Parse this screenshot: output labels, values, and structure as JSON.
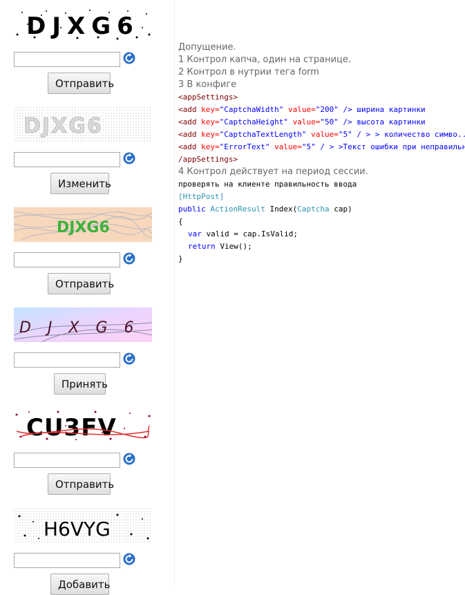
{
  "captchas": [
    {
      "text": "DJXG6",
      "button_label": "Отправить"
    },
    {
      "text": "DJXG6",
      "button_label": "Изменить"
    },
    {
      "text": "DJXG6",
      "button_label": "Отправить"
    },
    {
      "text": "DJXG6",
      "button_label": "Принять"
    },
    {
      "text": "CU3FV",
      "button_label": "Отправить"
    },
    {
      "text": "H6VYG",
      "button_label": "Добавить"
    }
  ],
  "notes": {
    "heading": "Допущение.",
    "item1": "1 Контрол капча, один на странице.",
    "item2": "2 Контрол в нутрии тега form",
    "item3": "3 В конфиге",
    "config": {
      "open_tag": "<appSettings>",
      "add": "<add",
      "key_attr": "key=",
      "value_attr": "value=",
      "close_slash": "/>",
      "close_slash_spaced": "/ >",
      "close_tag": "/appSettings>",
      "rows": [
        {
          "key": "\"CaptchaWidth\"",
          "value": "\"200\"",
          "comment": "ширина картинки"
        },
        {
          "key": "\"CaptchaHeight\"",
          "value": "\"50\"",
          "comment": "высота картинки"
        },
        {
          "key": "\"CaptchaTextLength\"",
          "value": "\"5\"",
          "comment": "> количество симво..."
        },
        {
          "key": "\"ErrorText\"",
          "value": "\"5\"",
          "comment": ">Текст ошибки при неправильном"
        }
      ]
    },
    "item4": "4 Контрол действует на период сессии.",
    "code": {
      "comment": "проверять на клиенте правильность ввода",
      "attribute": "[HttpPost]",
      "kw_public": "public",
      "return_type": "ActionResult",
      "method": "Index(",
      "param_type": "Captcha",
      "param_name": "cap)",
      "brace_open": "{",
      "kw_var": "var",
      "assign": "valid = cap.IsValid;",
      "kw_return": "return",
      "return_expr": "View();",
      "brace_close": "}"
    }
  }
}
